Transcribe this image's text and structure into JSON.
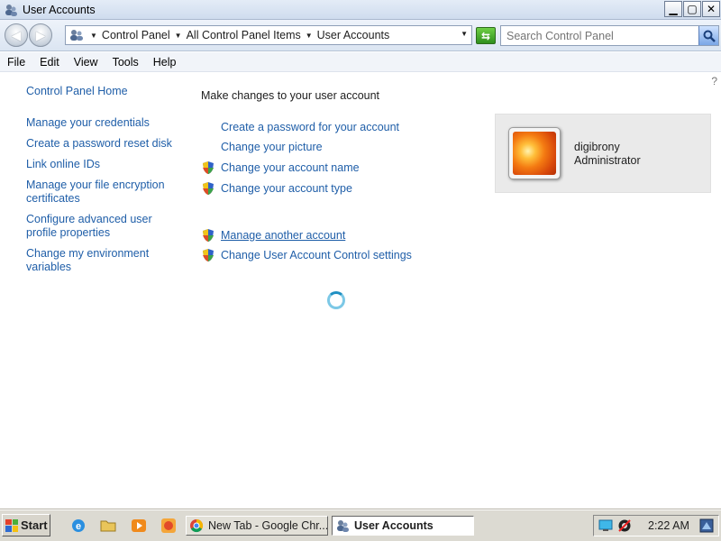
{
  "window": {
    "title": "User Accounts",
    "controls": {
      "minimize": "▁",
      "maximize": "▢",
      "close": "✕"
    }
  },
  "address_bar": {
    "crumbs": [
      "Control Panel",
      "All Control Panel Items",
      "User Accounts"
    ],
    "search_placeholder": "Search Control Panel"
  },
  "menu": [
    "File",
    "Edit",
    "View",
    "Tools",
    "Help"
  ],
  "left_nav": {
    "home": "Control Panel Home",
    "links": [
      "Manage your credentials",
      "Create a password reset disk",
      "Link online IDs",
      "Manage your file encryption certificates",
      "Configure advanced user profile properties",
      "Change my environment variables"
    ]
  },
  "main": {
    "heading": "Make changes to your user account",
    "tasks": [
      {
        "label": "Create a password for your account",
        "icon": "none"
      },
      {
        "label": "Change your picture",
        "icon": "none"
      },
      {
        "label": "Change your account name",
        "icon": "uac-shield-icon"
      },
      {
        "label": "Change your account type",
        "icon": "uac-shield-icon"
      }
    ],
    "more_tasks": [
      {
        "label": "Manage another account",
        "icon": "uac-shield-icon"
      },
      {
        "label": "Change User Account Control settings",
        "icon": "uac-shield-icon"
      }
    ]
  },
  "account": {
    "name": "digibrony",
    "role": "Administrator",
    "picture": "orange-flower-picture"
  },
  "taskbar": {
    "start_label": "Start",
    "quick_launch": [
      "internet-explorer-icon",
      "folder-icon",
      "media-player-icon",
      "app-icon"
    ],
    "tasks": [
      {
        "label": "New Tab - Google Chr...",
        "icon": "chrome-icon",
        "active": false
      },
      {
        "label": "User Accounts",
        "icon": "user-accounts-icon",
        "active": true
      }
    ],
    "clock": "2:22 AM"
  },
  "colors": {
    "link": "#1f5ea8",
    "card_bg": "#eaeaea",
    "taskbar_bg": "#dcdad2"
  }
}
